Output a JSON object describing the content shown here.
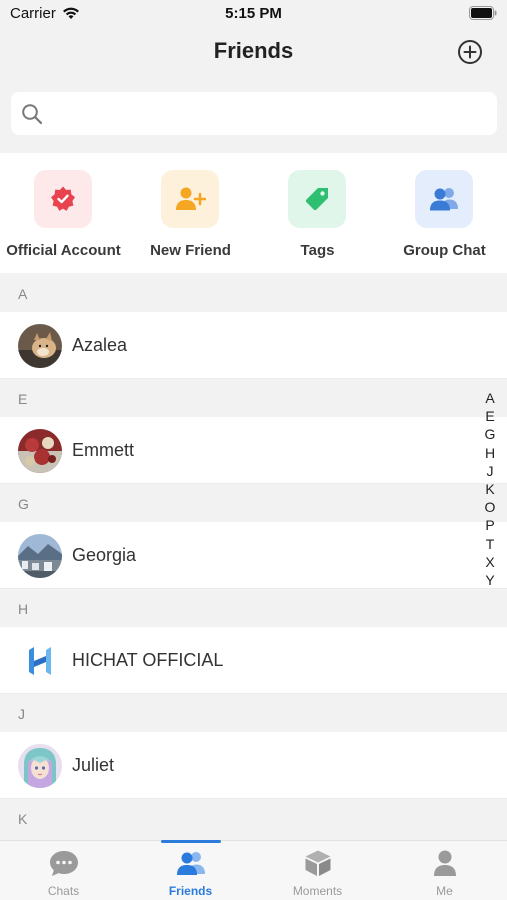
{
  "status_bar": {
    "carrier": "Carrier",
    "time": "5:15 PM"
  },
  "header": {
    "title": "Friends"
  },
  "search": {
    "placeholder": ""
  },
  "quick_actions": [
    {
      "label": "Official Account",
      "icon": "badge-check-icon",
      "color": "#e8434f",
      "bg": "#fde9ea"
    },
    {
      "label": "New Friend",
      "icon": "add-user-icon",
      "color": "#f5a623",
      "bg": "#fdf1dc"
    },
    {
      "label": "Tags",
      "icon": "tag-icon",
      "color": "#2fbf71",
      "bg": "#e0f6ea"
    },
    {
      "label": "Group Chat",
      "icon": "group-icon",
      "color": "#3a7bd5",
      "bg": "#e3edfb"
    }
  ],
  "sections": [
    {
      "letter": "A",
      "contacts": [
        {
          "name": "Azalea",
          "avatar": "dog-photo"
        }
      ]
    },
    {
      "letter": "E",
      "contacts": [
        {
          "name": "Emmett",
          "avatar": "xmas-photo"
        }
      ]
    },
    {
      "letter": "G",
      "contacts": [
        {
          "name": "Georgia",
          "avatar": "city-photo"
        }
      ]
    },
    {
      "letter": "H",
      "contacts": [
        {
          "name": "HICHAT OFFICIAL",
          "avatar": "hichat-logo"
        }
      ]
    },
    {
      "letter": "J",
      "contacts": [
        {
          "name": "Juliet",
          "avatar": "anime-girl"
        }
      ]
    },
    {
      "letter": "K",
      "contacts": []
    }
  ],
  "index_letters": [
    "A",
    "E",
    "G",
    "H",
    "J",
    "K",
    "O",
    "P",
    "T",
    "X",
    "Y"
  ],
  "tabs": [
    {
      "label": "Chats",
      "icon": "chat-bubble-icon",
      "active": false
    },
    {
      "label": "Friends",
      "icon": "friends-icon",
      "active": true
    },
    {
      "label": "Moments",
      "icon": "box-icon",
      "active": false
    },
    {
      "label": "Me",
      "icon": "person-icon",
      "active": false
    }
  ],
  "colors": {
    "accent": "#2b7bdc",
    "background": "#f2f2f2",
    "inactive_tab": "#9a9a9a"
  }
}
